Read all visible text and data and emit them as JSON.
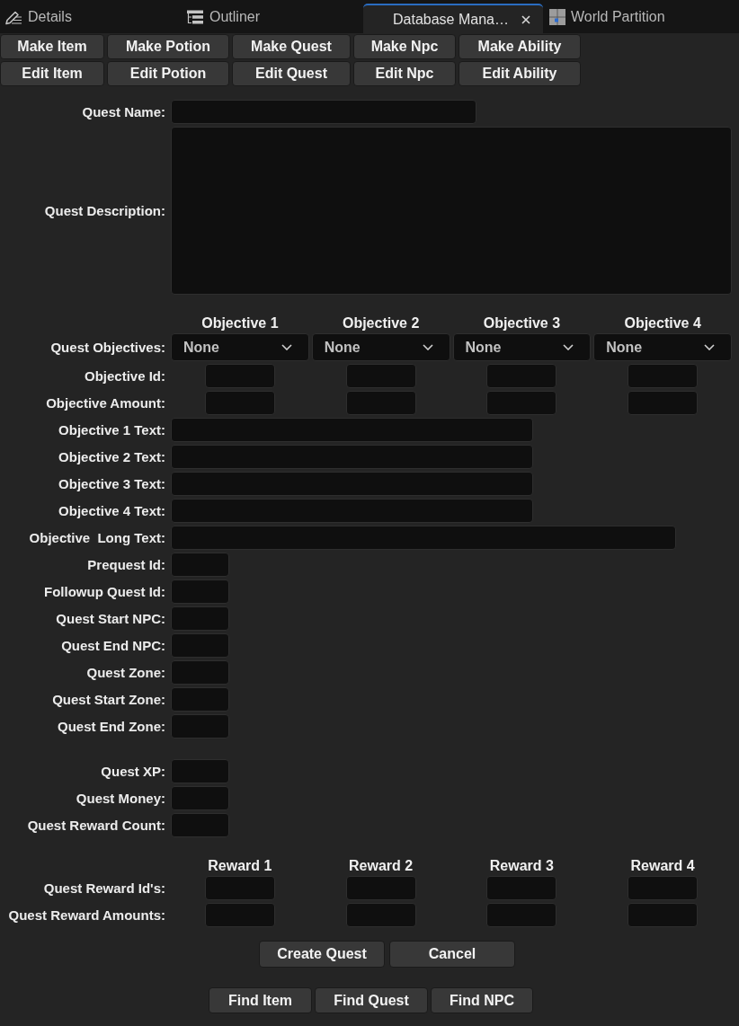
{
  "tabs": [
    {
      "label": "Details",
      "selected": false,
      "closable": false
    },
    {
      "label": "Outliner",
      "selected": false,
      "closable": false
    },
    {
      "label": "Database Mana…",
      "selected": true,
      "closable": true
    },
    {
      "label": "World Partition",
      "selected": false,
      "closable": false
    }
  ],
  "toolbar": {
    "rows": [
      [
        "Make Item",
        "Make Potion",
        "Make Quest",
        "Make Npc",
        "Make Ability"
      ],
      [
        "Edit Item",
        "Edit Potion",
        "Edit Quest",
        "Edit Npc",
        "Edit Ability"
      ]
    ]
  },
  "form": {
    "sections": [
      {
        "rows": [
          {
            "kind": "name",
            "label": "Quest Name:"
          },
          {
            "kind": "description",
            "label": "Quest Description:"
          }
        ]
      },
      {
        "columns": [
          "Objective 1",
          "Objective 2",
          "Objective 3",
          "Objective 4"
        ],
        "rows": [
          {
            "kind": "dropdowns",
            "label": "Quest Objectives:",
            "values": [
              "None",
              "None",
              "None",
              "None"
            ]
          },
          {
            "kind": "column-fields",
            "label": "Objective Id:"
          },
          {
            "kind": "column-fields",
            "label": "Objective Amount:"
          },
          {
            "kind": "text",
            "label": "Objective 1 Text:"
          },
          {
            "kind": "text",
            "label": "Objective 2 Text:"
          },
          {
            "kind": "text",
            "label": "Objective 3 Text:"
          },
          {
            "kind": "text",
            "label": "Objective 4 Text:"
          },
          {
            "kind": "long",
            "label": "Objective  Long Text:"
          },
          {
            "kind": "short",
            "label": "Prequest Id:"
          },
          {
            "kind": "short",
            "label": "Followup Quest Id:"
          },
          {
            "kind": "short",
            "label": "Quest Start NPC:"
          },
          {
            "kind": "short",
            "label": "Quest End NPC:"
          },
          {
            "kind": "short",
            "label": "Quest Zone:"
          },
          {
            "kind": "short",
            "label": "Quest Start Zone:"
          },
          {
            "kind": "short",
            "label": "Quest End Zone:"
          }
        ]
      },
      {
        "rows": [
          {
            "kind": "short",
            "label": "Quest XP:"
          },
          {
            "kind": "short",
            "label": "Quest Money:"
          },
          {
            "kind": "short",
            "label": "Quest Reward Count:"
          }
        ]
      },
      {
        "columns": [
          "Reward 1",
          "Reward 2",
          "Reward 3",
          "Reward 4"
        ],
        "rows": [
          {
            "kind": "column-fields",
            "label": "Quest Reward Id's:"
          },
          {
            "kind": "column-fields",
            "label": "Quest Reward Amounts:"
          }
        ]
      }
    ],
    "actions": [
      "Create Quest",
      "Cancel"
    ],
    "find_buttons": [
      "Find Item",
      "Find Quest",
      "Find NPC"
    ]
  }
}
